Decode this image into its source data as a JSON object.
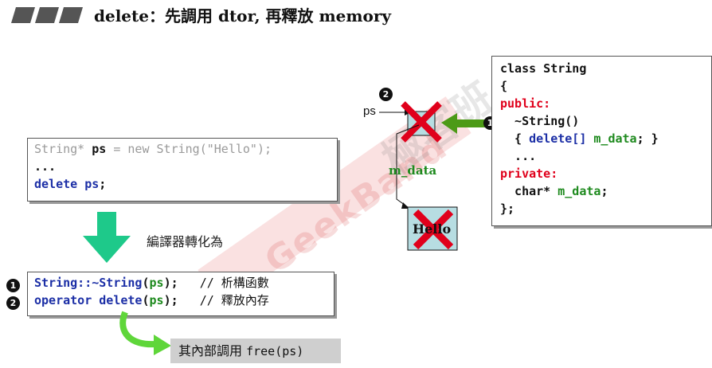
{
  "title": "delete：先調用 dtor, 再釋放 memory",
  "code1": {
    "line1_a": "String* ",
    "line1_b": "ps",
    "line1_c": " = new String(\"Hello\");",
    "line2": "...",
    "line3_a": "delete ",
    "line3_b": "ps",
    "line3_c": ";"
  },
  "convert_label": "編譯器轉化為",
  "code2": {
    "row1": {
      "badge": "1",
      "a": "String::~String",
      "b": "(",
      "c": "ps",
      "d": ");",
      "comment": "   // 析構函數"
    },
    "row2": {
      "badge": "2",
      "a": "operator delete",
      "b": "(",
      "c": "ps",
      "d": ");",
      "comment": "   // 釋放內存"
    }
  },
  "free_label": {
    "text": "其內部調用 ",
    "code": "free(ps)"
  },
  "diagram": {
    "ps_label": "ps",
    "mdata_label": "m_data",
    "hello_text": "Hello",
    "badge_ps": "2",
    "badge_dtor": "1"
  },
  "code3": {
    "l1": "class String",
    "l2": "{",
    "l3": "public:",
    "l4": "  ~String()",
    "l5_a": "  { ",
    "l5_b": "delete[]",
    "l5_c": " ",
    "l5_d": "m_data",
    "l5_e": "; }",
    "l6": "  ...",
    "l7": "private:",
    "l8_a": "  char* ",
    "l8_b": "m_data",
    "l8_c": ";",
    "l9": "};"
  },
  "watermark": {
    "text": "GeekBand",
    "cjk": "極客班"
  },
  "colors": {
    "blue": "#1c2fa6",
    "green": "#1e8a1e",
    "red": "#e0001b",
    "arrow_green": "#1ec98a",
    "diagram_box": "#b7dde2"
  }
}
